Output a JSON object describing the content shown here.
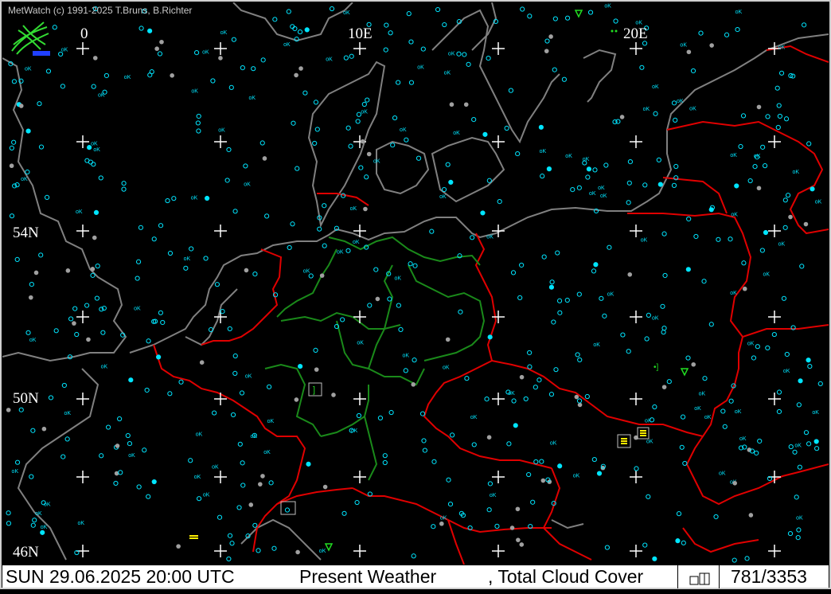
{
  "credit": "MetWatch  (c) 1991-2025 T.Bruns, B.Richter",
  "labels": {
    "lon0": "0",
    "lon10": "10E",
    "lon20": "20E",
    "lat54": "54N",
    "lat50": "50N",
    "lat46": "46N"
  },
  "station_marker_text": "oK",
  "status": {
    "datetime": "SUN 29.06.2025 20:00 UTC",
    "parameter1": "Present Weather",
    "parameter2": ", Total Cloud Cover",
    "count": "781/3353"
  },
  "colors": {
    "background": "#000000",
    "coastline": "#808080",
    "borders": "#e00000",
    "states": "#1a8a1a",
    "stations": "#00e5ff",
    "grid": "#ffffff",
    "statusbar": "#ffffff"
  },
  "icons": [
    "metwatch-logo-icon",
    "grid-cross-icon",
    "station-circle-icon",
    "rain-shower-icon",
    "fog-icon"
  ]
}
